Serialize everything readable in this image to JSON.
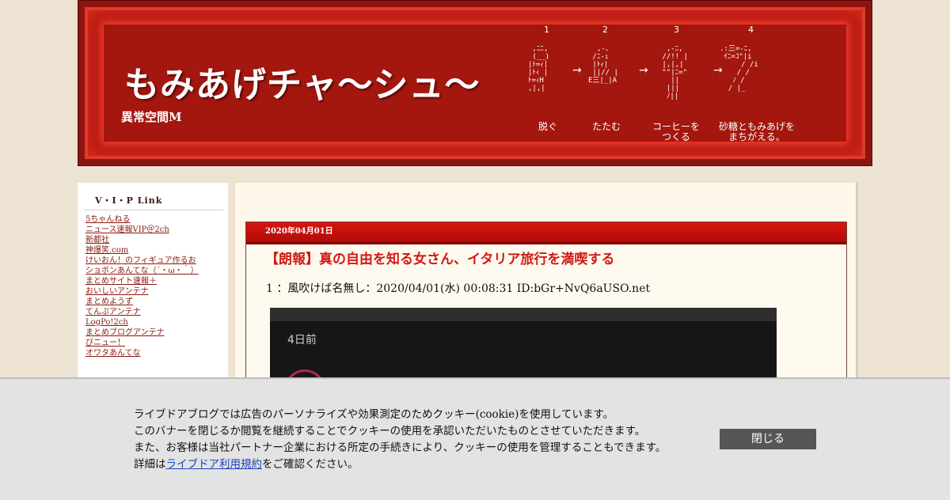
{
  "header": {
    "title": "もみあげチャ～シュ～",
    "subtitle": "異常空間M",
    "steps": [
      {
        "num": "1",
        "caption": "脱ぐ"
      },
      {
        "num": "2",
        "caption": "たたむ"
      },
      {
        "num": "3",
        "caption": "コーヒーを\nつくる"
      },
      {
        "num": "4",
        "caption": "砂糖ともみあげを\nまちがえる。"
      }
    ],
    "arrow": "→"
  },
  "sidebar": {
    "title": "V・I・P Link",
    "links": [
      "5ちゃんねる",
      "ニュース速報VIP＠2ch",
      "新都社",
      "神爆笑.com",
      "けいおん！のフィギュア作るお",
      "ショボンあんてな（´・ω・｀）",
      "まとめサイト速報＋",
      "おいしいアンテナ",
      "まとめようず",
      "てんぷアンテナ",
      "LogPo!2ch",
      "まとめブログアンテナ",
      "びニュー！",
      "オワタあんてな"
    ]
  },
  "post": {
    "date": "2020年04月01日",
    "title": "【朗報】真の自由を知る女さん、イタリア旅行を満喫する",
    "first_line": "1 ：風吹けば名無し：2020/04/01(水) 00:08:31 ID:bGr+NvQ6aUSO.net",
    "image_text": "4日前"
  },
  "cookie": {
    "line1": "ライブドアブログでは広告のパーソナライズや効果測定のためクッキー(cookie)を使用しています。",
    "line2": "このバナーを閉じるか閲覧を継続することでクッキーの使用を承認いただいたものとさせていただきます。",
    "line3": "また、お客様は当社パートナー企業における所定の手続きにより、クッキーの使用を管理することもできます。",
    "line4_prefix": "詳細は",
    "line4_link": "ライブドア利用規約",
    "line4_suffix": "をご確認ください。",
    "close_label": "閉じる"
  },
  "colors": {
    "header_red": "#a1160f",
    "post_title_red": "#d11a12",
    "link_color": "#8a1a10",
    "page_bg": "#ece3d3"
  }
}
